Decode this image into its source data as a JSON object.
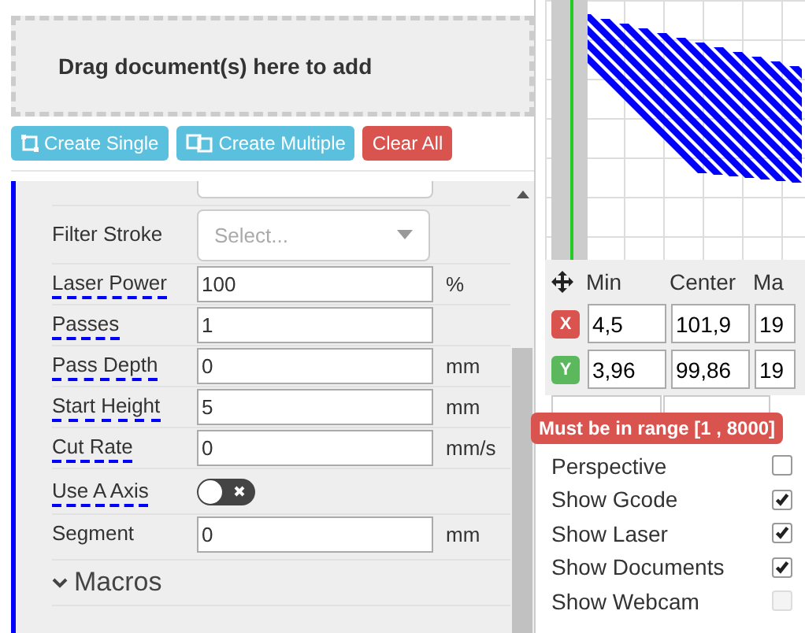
{
  "dropzone": {
    "text": "Drag document(s) here to add"
  },
  "actions": [
    {
      "label": "Create Single",
      "kind": "single"
    },
    {
      "label": "Create Multiple",
      "kind": "multiple"
    },
    {
      "label": "Clear All",
      "kind": "danger"
    }
  ],
  "fields": [
    {
      "kind": "select",
      "label": "Filter Stroke",
      "placeholder": "Select...",
      "hint": false
    },
    {
      "kind": "input",
      "label": "Laser Power",
      "value": "100",
      "unit": "%",
      "hint": true
    },
    {
      "kind": "input",
      "label": "Passes",
      "value": "1",
      "hint": true
    },
    {
      "kind": "input",
      "label": "Pass Depth",
      "value": "0",
      "unit": "mm",
      "hint": true
    },
    {
      "kind": "input",
      "label": "Start Height",
      "value": "5",
      "unit": "mm",
      "hint": true
    },
    {
      "kind": "input",
      "label": "Cut Rate",
      "value": "0",
      "unit": "mm/s",
      "hint": true
    },
    {
      "kind": "toggle",
      "label": "Use A Axis",
      "on": false,
      "hint": true
    },
    {
      "kind": "input",
      "label": "Segment",
      "value": "0",
      "unit": "mm",
      "hint": false
    }
  ],
  "macros": {
    "label": "Macros",
    "expanded": false
  },
  "coords": {
    "columns": [
      "Min",
      "Center",
      "Ma"
    ],
    "rows": [
      {
        "axis": "X",
        "color": "#d9534f",
        "values": [
          "4,5",
          "101,9",
          "19"
        ]
      },
      {
        "axis": "Y",
        "color": "#5cb85c",
        "values": [
          "3,96",
          "99,86",
          "19"
        ]
      }
    ]
  },
  "view_buttons": [
    {
      "kind": "mach"
    },
    {
      "kind": "doc"
    }
  ],
  "tooltip": "Must be in range [1 , 8000]",
  "options": [
    {
      "label": "Perspective",
      "checked": false,
      "disabled": false
    },
    {
      "label": "Show Gcode",
      "checked": true,
      "disabled": false
    },
    {
      "label": "Show Laser",
      "checked": true,
      "disabled": false
    },
    {
      "label": "Show Documents",
      "checked": true,
      "disabled": false
    },
    {
      "label": "Show Webcam",
      "checked": false,
      "disabled": true
    }
  ]
}
